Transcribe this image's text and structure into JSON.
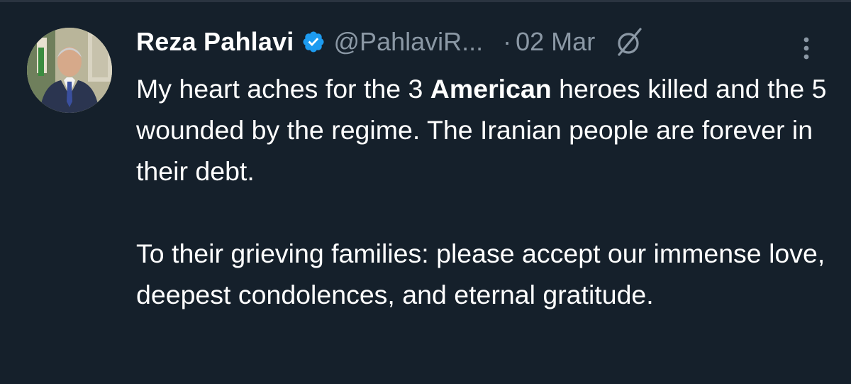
{
  "tweet": {
    "author_name": "Reza Pahlavi",
    "handle": "@PahlaviR...",
    "separator": "·",
    "date": "02 Mar",
    "verified_badge_color": "#1d9bf0",
    "text": {
      "line_part1": "My heart aches for the 3 ",
      "bold_word": "American",
      "line_part2": " heroes killed and the 5 wounded by the regime. The Iranian people are forever in their debt.",
      "paragraph2": "To their grieving families: please accept our immense love, deepest condolences, and eternal gratitude."
    }
  },
  "icons": {
    "avatar": "profile-photo",
    "verified": "verified-badge-icon",
    "grok": "grok-icon",
    "more": "more-options-icon"
  },
  "colors": {
    "background": "#15202b",
    "text_primary": "#ffffff",
    "text_secondary": "#8b98a5"
  }
}
